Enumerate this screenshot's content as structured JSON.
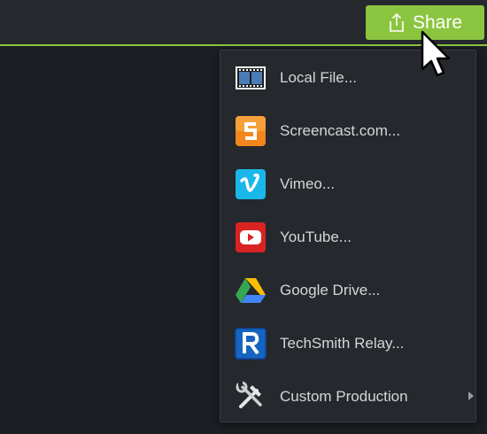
{
  "toolbar": {
    "share_label": "Share",
    "accent_color": "#8bc53f"
  },
  "share_menu": {
    "items": [
      {
        "label": "Local File...",
        "icon": "film-strip-icon"
      },
      {
        "label": "Screencast.com...",
        "icon": "screencast-icon"
      },
      {
        "label": "Vimeo...",
        "icon": "vimeo-icon"
      },
      {
        "label": "YouTube...",
        "icon": "youtube-icon"
      },
      {
        "label": "Google Drive...",
        "icon": "google-drive-icon"
      },
      {
        "label": "TechSmith Relay...",
        "icon": "techsmith-relay-icon"
      },
      {
        "label": "Custom Production",
        "icon": "tools-icon",
        "has_submenu": true
      }
    ]
  }
}
